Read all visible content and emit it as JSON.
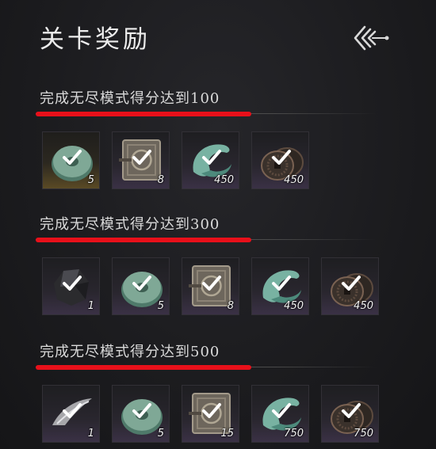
{
  "header": {
    "title": "关卡奖励",
    "back_icon": "triple-chevron-left-icon"
  },
  "colors": {
    "highlight_underline": "#e8101a",
    "background": "#1c1c1f"
  },
  "sections": [
    {
      "title": "完成无尽模式得分达到100",
      "rewards": [
        {
          "icon": "jade-disc-icon",
          "count": "5",
          "claimed": true
        },
        {
          "icon": "bronze-plaque-icon",
          "count": "8",
          "claimed": true
        },
        {
          "icon": "jade-swirl-icon",
          "count": "450",
          "claimed": true
        },
        {
          "icon": "copper-coins-icon",
          "count": "450",
          "claimed": true
        }
      ]
    },
    {
      "title": "完成无尽模式得分达到300",
      "rewards": [
        {
          "icon": "dark-ore-icon",
          "count": "1",
          "claimed": true
        },
        {
          "icon": "jade-disc-icon",
          "count": "5",
          "claimed": true
        },
        {
          "icon": "bronze-plaque-icon",
          "count": "8",
          "claimed": true
        },
        {
          "icon": "jade-swirl-icon",
          "count": "450",
          "claimed": true
        },
        {
          "icon": "copper-coins-icon",
          "count": "450",
          "claimed": true
        }
      ]
    },
    {
      "title": "完成无尽模式得分达到500",
      "rewards": [
        {
          "icon": "silver-feather-icon",
          "count": "1",
          "claimed": true
        },
        {
          "icon": "jade-disc-icon",
          "count": "5",
          "claimed": true
        },
        {
          "icon": "bronze-plaque-icon",
          "count": "15",
          "claimed": true
        },
        {
          "icon": "jade-swirl-icon",
          "count": "750",
          "claimed": true
        },
        {
          "icon": "copper-coins-icon",
          "count": "750",
          "claimed": true
        }
      ]
    }
  ]
}
